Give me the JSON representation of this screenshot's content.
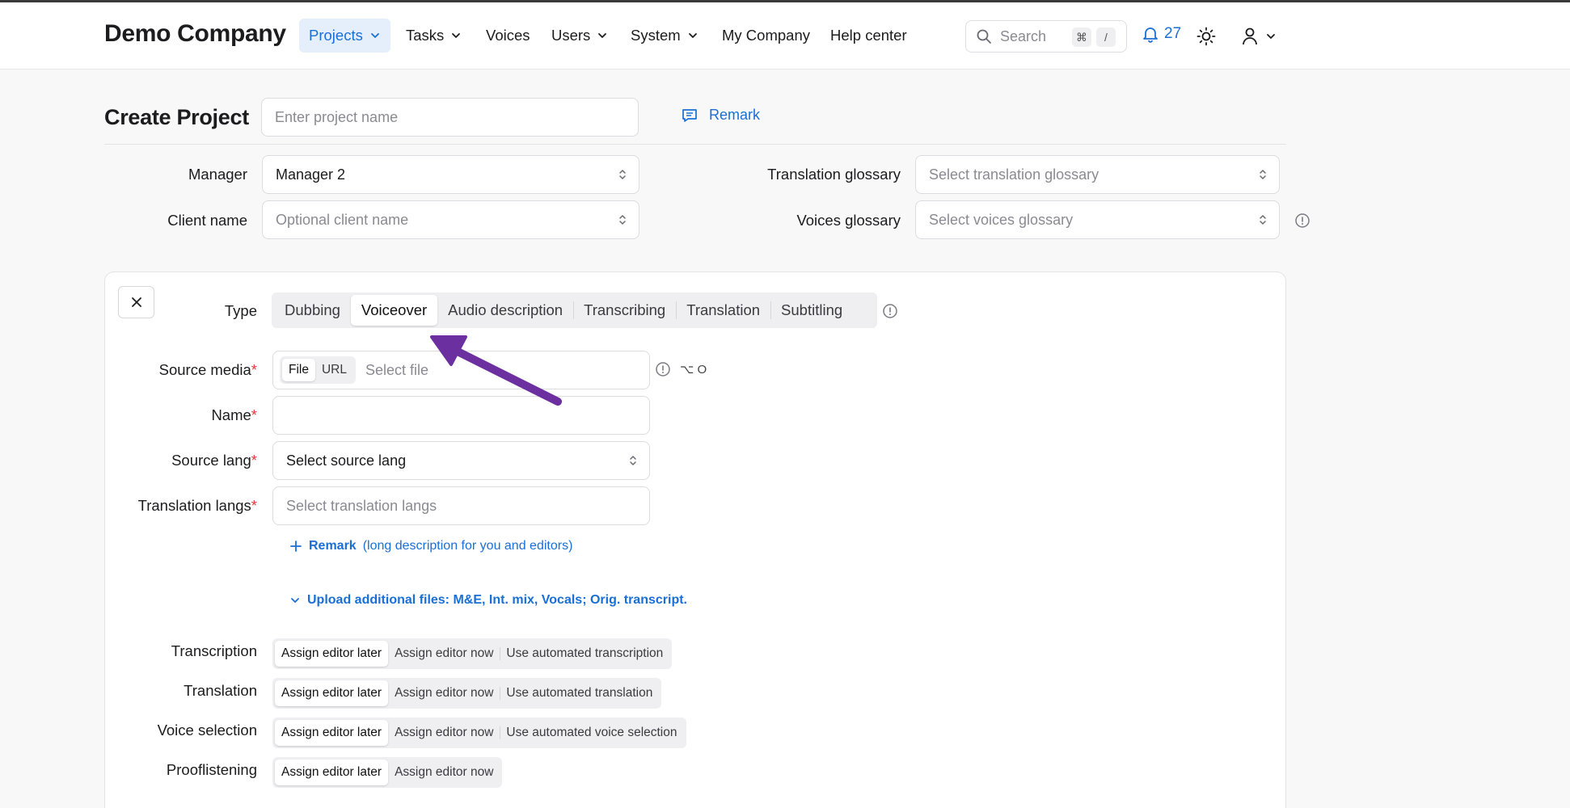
{
  "header": {
    "brand": "Demo Company",
    "nav": [
      {
        "label": "Projects",
        "dropdown": true,
        "active": true
      },
      {
        "label": "Tasks",
        "dropdown": true
      },
      {
        "label": "Voices",
        "dropdown": false
      },
      {
        "label": "Users",
        "dropdown": true
      },
      {
        "label": "System",
        "dropdown": true
      },
      {
        "label": "My Company",
        "dropdown": false
      },
      {
        "label": "Help center",
        "dropdown": false
      }
    ],
    "search_placeholder": "Search",
    "search_kbd_1": "⌘",
    "search_kbd_2": "/",
    "notifications_count": "27"
  },
  "title_row": {
    "title": "Create Project",
    "project_name_placeholder": "Enter project name",
    "remark_label": "Remark"
  },
  "meta": {
    "manager_label": "Manager",
    "manager_value": "Manager 2",
    "client_label": "Client name",
    "client_placeholder": "Optional client name",
    "translation_glossary_label": "Translation glossary",
    "translation_glossary_placeholder": "Select translation glossary",
    "voices_glossary_label": "Voices glossary",
    "voices_glossary_placeholder": "Select voices glossary"
  },
  "form": {
    "type_label": "Type",
    "types": [
      "Dubbing",
      "Voiceover",
      "Audio description",
      "Transcribing",
      "Translation",
      "Subtitling"
    ],
    "selected_type": "Voiceover",
    "source_media_label": "Source media",
    "source_media_modes": [
      "File",
      "URL"
    ],
    "source_media_placeholder": "Select file",
    "source_media_shortcut": "⌥ O",
    "name_label": "Name",
    "name_value": "",
    "source_lang_label": "Source lang",
    "source_lang_value": "Select source lang",
    "translation_langs_label": "Translation langs",
    "translation_langs_placeholder": "Select translation langs",
    "remark_link": "Remark",
    "remark_hint": "(long description for you and editors)",
    "upload_link": "Upload additional files: M&E, Int. mix, Vocals; Orig. transcript.",
    "stages": [
      {
        "label": "Transcription",
        "options": [
          "Assign editor later",
          "Assign editor now",
          "Use automated transcription"
        ]
      },
      {
        "label": "Translation",
        "options": [
          "Assign editor later",
          "Assign editor now",
          "Use automated translation"
        ]
      },
      {
        "label": "Voice selection",
        "options": [
          "Assign editor later",
          "Assign editor now",
          "Use automated voice selection"
        ]
      },
      {
        "label": "Prooflistening",
        "options": [
          "Assign editor later",
          "Assign editor now"
        ]
      }
    ]
  },
  "colors": {
    "accent": "#1a6fd6",
    "arrow": "#6b2fa0",
    "required": "#e23b3b"
  }
}
